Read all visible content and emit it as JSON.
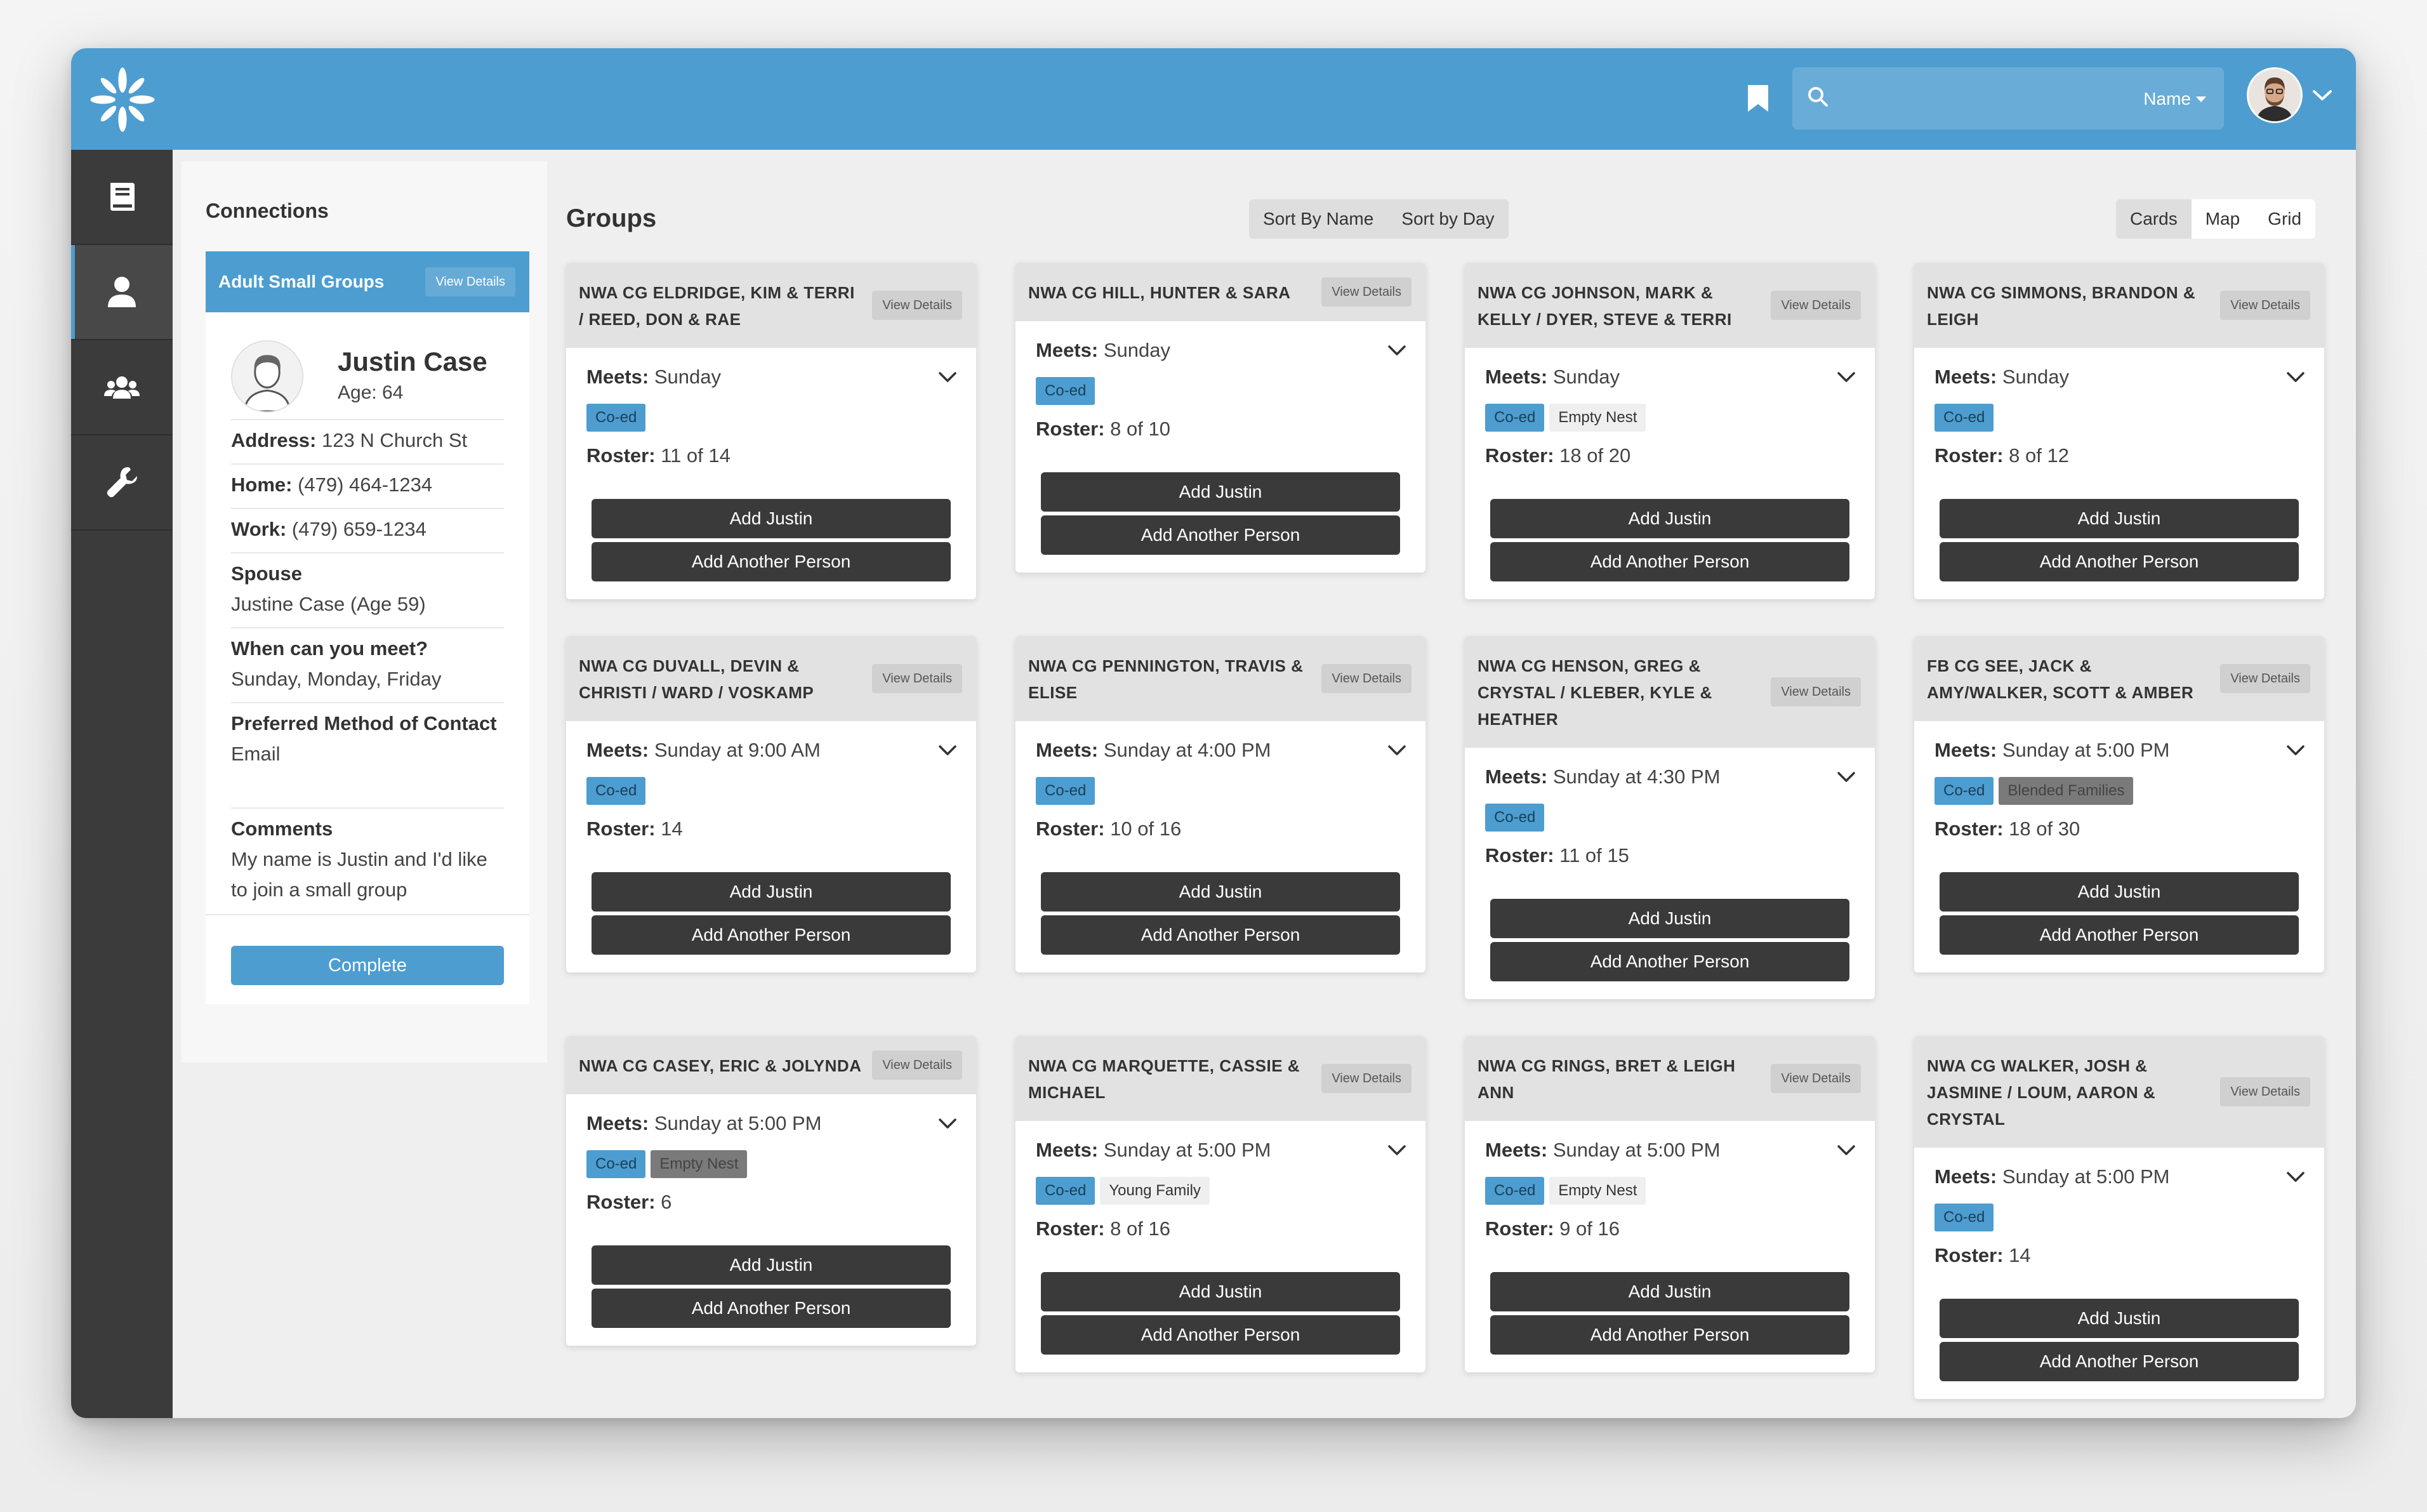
{
  "header": {
    "search_placeholder": "",
    "search_filter_label": "Name"
  },
  "colors": {
    "brand": "#4d9dd0",
    "dark": "#3a3a3a",
    "rail": "#3b3b3b"
  },
  "rail": [
    "book-icon",
    "person-icon",
    "people-icon",
    "wrench-icon"
  ],
  "connections": {
    "title": "Connections",
    "card_title": "Adult Small Groups",
    "view_details": "View Details",
    "name": "Justin Case",
    "age": "Age: 64",
    "address_label": "Address:",
    "address": "123 N Church St",
    "home_label": "Home:",
    "home": "(479) 464-1234",
    "work_label": "Work:",
    "work": "(479) 659-1234",
    "spouse_label": "Spouse",
    "spouse": "Justine Case (Age 59)",
    "meet_label": "When can you meet?",
    "meet": "Sunday, Monday, Friday",
    "contact_label": "Preferred Method of Contact",
    "contact": "Email",
    "comments_label": "Comments",
    "comments": "My name is Justin and I'd like to join a small group",
    "complete": "Complete"
  },
  "groups": {
    "title": "Groups",
    "sort_by_name": "Sort By Name",
    "sort_by_day": "Sort by Day",
    "views": [
      "Cards",
      "Map",
      "Grid"
    ],
    "labels": {
      "view_details": "View Details",
      "meets": "Meets:",
      "roster": "Roster:",
      "add_justin": "Add Justin",
      "add_another": "Add Another Person"
    },
    "cards": [
      {
        "title": "NWA CG ELDRIDGE, KIM & TERRI / REED, DON & RAE",
        "meets": "Sunday",
        "tags": [
          {
            "label": "Co-ed",
            "style": "blue"
          }
        ],
        "roster": "11 of 14"
      },
      {
        "title": "NWA CG HILL, HUNTER & SARA",
        "meets": "Sunday",
        "tags": [
          {
            "label": "Co-ed",
            "style": "blue"
          }
        ],
        "roster": "8 of 10"
      },
      {
        "title": "NWA CG JOHNSON, MARK & KELLY / DYER, STEVE & TERRI",
        "meets": "Sunday",
        "tags": [
          {
            "label": "Co-ed",
            "style": "blue"
          },
          {
            "label": "Empty Nest",
            "style": "light"
          }
        ],
        "roster": "18 of 20"
      },
      {
        "title": "NWA CG SIMMONS, BRANDON & LEIGH",
        "meets": "Sunday",
        "tags": [
          {
            "label": "Co-ed",
            "style": "blue"
          }
        ],
        "roster": "8 of 12"
      },
      {
        "title": "NWA CG DUVALL, DEVIN & CHRISTI / WARD / VOSKAMP",
        "meets": "Sunday at 9:00 AM",
        "tags": [
          {
            "label": "Co-ed",
            "style": "blue"
          }
        ],
        "roster": "14"
      },
      {
        "title": "NWA CG PENNINGTON, TRAVIS & ELISE",
        "meets": "Sunday at 4:00 PM",
        "tags": [
          {
            "label": "Co-ed",
            "style": "blue"
          }
        ],
        "roster": "10 of 16"
      },
      {
        "title": "NWA CG HENSON, GREG & CRYSTAL / KLEBER, KYLE & HEATHER",
        "meets": "Sunday at 4:30 PM",
        "tags": [
          {
            "label": "Co-ed",
            "style": "blue"
          }
        ],
        "roster": "11 of 15"
      },
      {
        "title": "FB CG SEE, JACK & AMY/WALKER, SCOTT & AMBER",
        "meets": "Sunday at 5:00 PM",
        "tags": [
          {
            "label": "Co-ed",
            "style": "blue"
          },
          {
            "label": "Blended Families",
            "style": "dark"
          }
        ],
        "roster": "18 of 30"
      },
      {
        "title": "NWA CG CASEY, ERIC & JOLYNDA",
        "meets": "Sunday at 5:00 PM",
        "tags": [
          {
            "label": "Co-ed",
            "style": "blue"
          },
          {
            "label": "Empty Nest",
            "style": "dark"
          }
        ],
        "roster": "6"
      },
      {
        "title": "NWA CG MARQUETTE, CASSIE & MICHAEL",
        "meets": "Sunday at 5:00 PM",
        "tags": [
          {
            "label": "Co-ed",
            "style": "blue"
          },
          {
            "label": "Young Family",
            "style": "light"
          }
        ],
        "roster": "8 of 16"
      },
      {
        "title": "NWA CG RINGS, BRET & LEIGH ANN",
        "meets": "Sunday at 5:00 PM",
        "tags": [
          {
            "label": "Co-ed",
            "style": "blue"
          },
          {
            "label": "Empty Nest",
            "style": "light"
          }
        ],
        "roster": "9 of 16"
      },
      {
        "title": "NWA CG WALKER, JOSH & JASMINE / LOUM, AARON & CRYSTAL",
        "meets": "Sunday at 5:00 PM",
        "tags": [
          {
            "label": "Co-ed",
            "style": "blue"
          }
        ],
        "roster": "14"
      }
    ]
  }
}
